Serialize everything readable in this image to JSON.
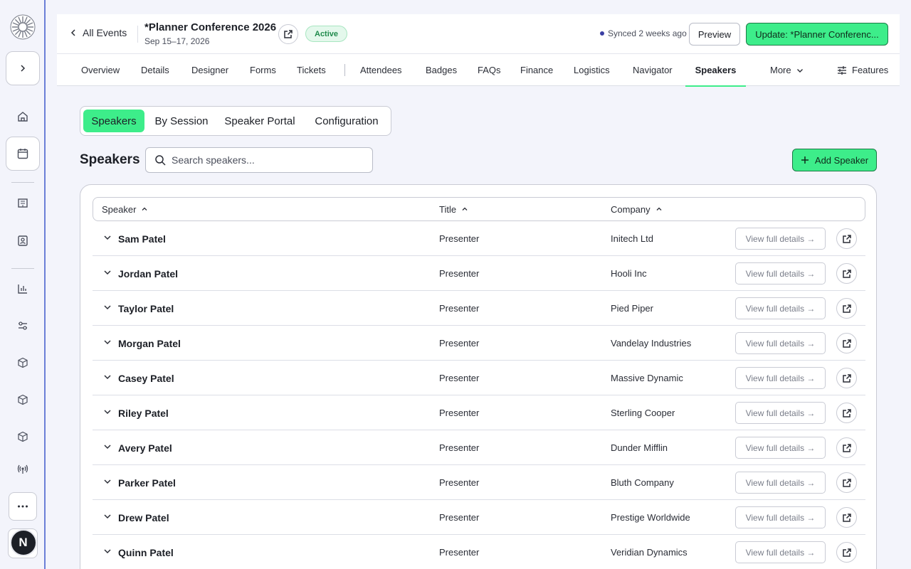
{
  "sidebar": {
    "avatar_initial": "N"
  },
  "header": {
    "back_label": "All Events",
    "event_title": "*Planner Conference 2026",
    "event_dates": "Sep 15–17, 2026",
    "status": "Active",
    "synced": "Synced 2 weeks ago",
    "preview_label": "Preview",
    "update_label": "Update: *Planner Conferenc..."
  },
  "tabs": [
    {
      "label": "Overview"
    },
    {
      "label": "Details"
    },
    {
      "label": "Designer"
    },
    {
      "label": "Forms"
    },
    {
      "label": "Tickets"
    },
    {
      "label": "Attendees"
    },
    {
      "label": "Badges"
    },
    {
      "label": "FAQs"
    },
    {
      "label": "Finance"
    },
    {
      "label": "Logistics"
    },
    {
      "label": "Navigator"
    },
    {
      "label": "Speakers"
    },
    {
      "label": "More"
    }
  ],
  "features_label": "Features",
  "subtabs": [
    {
      "label": "Speakers"
    },
    {
      "label": "By Session"
    },
    {
      "label": "Speaker Portal"
    },
    {
      "label": "Configuration"
    }
  ],
  "page": {
    "title": "Speakers",
    "search_placeholder": "Search speakers...",
    "add_label": "Add Speaker"
  },
  "table": {
    "columns": [
      "Speaker",
      "Title",
      "Company"
    ],
    "details_label": "View full details →",
    "rows": [
      {
        "name": "Sam Patel",
        "title": "Presenter",
        "company": "Initech Ltd"
      },
      {
        "name": "Jordan Patel",
        "title": "Presenter",
        "company": "Hooli Inc"
      },
      {
        "name": "Taylor Patel",
        "title": "Presenter",
        "company": "Pied Piper"
      },
      {
        "name": "Morgan Patel",
        "title": "Presenter",
        "company": "Vandelay Industries"
      },
      {
        "name": "Casey Patel",
        "title": "Presenter",
        "company": "Massive Dynamic"
      },
      {
        "name": "Riley Patel",
        "title": "Presenter",
        "company": "Sterling Cooper"
      },
      {
        "name": "Avery Patel",
        "title": "Presenter",
        "company": "Dunder Mifflin"
      },
      {
        "name": "Parker Patel",
        "title": "Presenter",
        "company": "Bluth Company"
      },
      {
        "name": "Drew Patel",
        "title": "Presenter",
        "company": "Prestige Worldwide"
      },
      {
        "name": "Quinn Patel",
        "title": "Presenter",
        "company": "Veridian Dynamics"
      }
    ]
  }
}
